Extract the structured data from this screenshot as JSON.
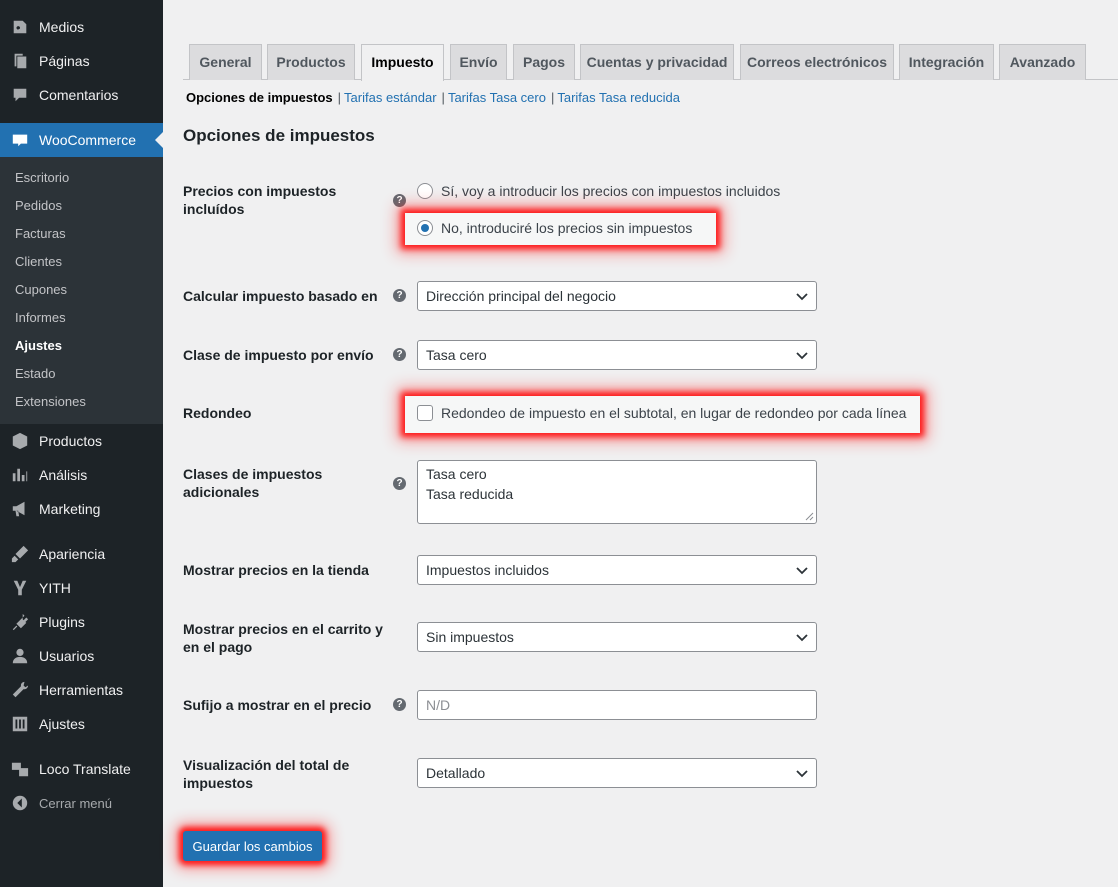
{
  "sidebar": {
    "items": [
      {
        "label": "Medios",
        "icon": "media-icon"
      },
      {
        "label": "Páginas",
        "icon": "pages-icon"
      },
      {
        "label": "Comentarios",
        "icon": "comments-icon"
      },
      {
        "label": "WooCommerce",
        "icon": "woocommerce-icon"
      },
      {
        "label": "Productos",
        "icon": "products-icon"
      },
      {
        "label": "Análisis",
        "icon": "analytics-icon"
      },
      {
        "label": "Marketing",
        "icon": "marketing-icon"
      },
      {
        "label": "Apariencia",
        "icon": "appearance-icon"
      },
      {
        "label": "YITH",
        "icon": "yith-icon"
      },
      {
        "label": "Plugins",
        "icon": "plugins-icon"
      },
      {
        "label": "Usuarios",
        "icon": "users-icon"
      },
      {
        "label": "Herramientas",
        "icon": "tools-icon"
      },
      {
        "label": "Ajustes",
        "icon": "settings-icon"
      },
      {
        "label": "Loco Translate",
        "icon": "translate-icon"
      },
      {
        "label": "Cerrar menú",
        "icon": "collapse-icon"
      }
    ],
    "woocommerce_submenu": [
      "Escritorio",
      "Pedidos",
      "Facturas",
      "Clientes",
      "Cupones",
      "Informes",
      "Ajustes",
      "Estado",
      "Extensiones"
    ],
    "current_submenu": "Ajustes"
  },
  "tabs": [
    "General",
    "Productos",
    "Impuesto",
    "Envío",
    "Pagos",
    "Cuentas y privacidad",
    "Correos electrónicos",
    "Integración",
    "Avanzado"
  ],
  "active_tab": "Impuesto",
  "subsub": {
    "current": "Opciones de impuestos",
    "links": [
      "Tarifas estándar",
      "Tarifas Tasa cero",
      "Tarifas Tasa reducida"
    ],
    "separator": "|"
  },
  "section_title": "Opciones de impuestos",
  "form": {
    "prices_incl_tax": {
      "label": "Precios con impuestos incluídos",
      "options": [
        "Sí, voy a introducir los precios con impuestos incluidos",
        "No, introduciré los precios sin impuestos"
      ],
      "selected": "No, introduciré los precios sin impuestos"
    },
    "tax_based_on": {
      "label": "Calcular impuesto basado en",
      "value": "Dirección principal del negocio"
    },
    "shipping_tax_class": {
      "label": "Clase de impuesto por envío",
      "value": "Tasa cero"
    },
    "rounding": {
      "label": "Redondeo",
      "checkbox_label": "Redondeo de impuesto en el subtotal, en lugar de redondeo por cada línea",
      "checked": false
    },
    "additional_classes": {
      "label": "Clases de impuestos adicionales",
      "lines": [
        "Tasa cero",
        "Tasa reducida"
      ]
    },
    "display_shop": {
      "label": "Mostrar precios en la tienda",
      "value": "Impuestos incluidos"
    },
    "display_cart": {
      "label": "Mostrar precios en el carrito y en el pago",
      "value": "Sin impuestos"
    },
    "price_suffix": {
      "label": "Sufijo a mostrar en el precio",
      "placeholder": "N/D"
    },
    "tax_total_display": {
      "label": "Visualización del total de impuestos",
      "value": "Detallado"
    }
  },
  "help_icon_glyph": "?",
  "save_button": "Guardar los cambios",
  "colors": {
    "accent": "#2271b1",
    "sidebar_bg": "#1d2327",
    "highlight": "#ff0000"
  }
}
